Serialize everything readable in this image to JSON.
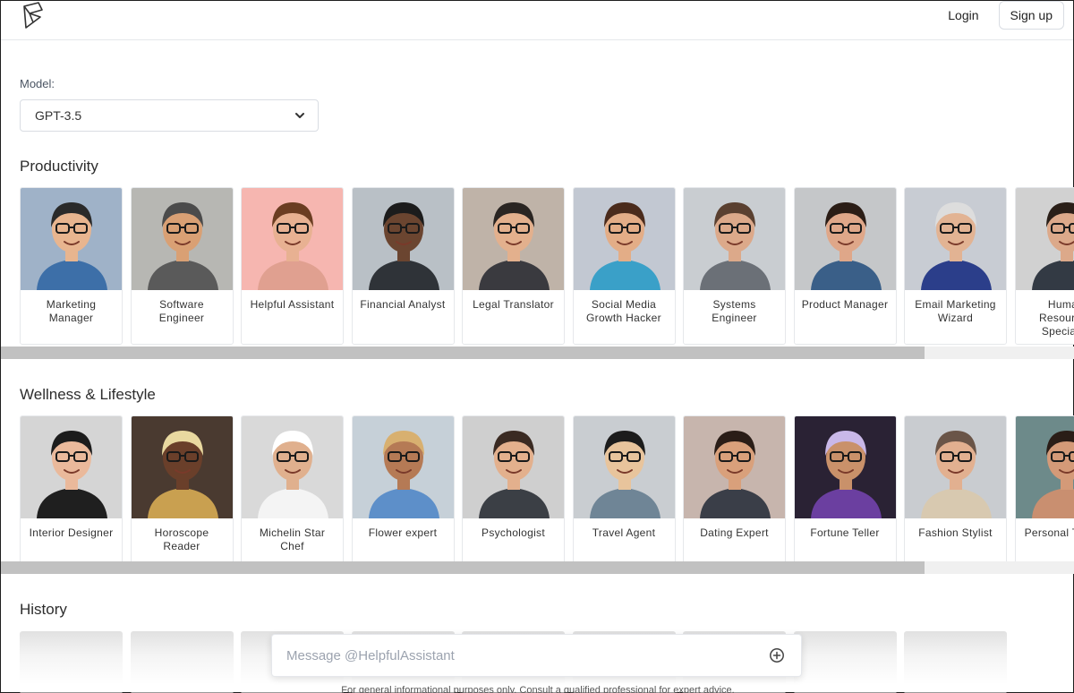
{
  "header": {
    "login_label": "Login",
    "signup_label": "Sign up"
  },
  "model": {
    "label": "Model:",
    "selected": "GPT-3.5"
  },
  "sections": {
    "productivity": {
      "title": "Productivity",
      "cards": [
        {
          "label": "Marketing Manager",
          "bg": "#9fb2c8",
          "skin": "#e8b58f",
          "hair": "#2a2a2a",
          "shirt": "#3d6fa8"
        },
        {
          "label": "Software Engineer",
          "bg": "#b7b7b3",
          "skin": "#d9a074",
          "hair": "#4b4b4b",
          "shirt": "#5a5a5a"
        },
        {
          "label": "Helpful Assistant",
          "bg": "#f6b6b0",
          "skin": "#e8b192",
          "hair": "#6b3d22",
          "shirt": "#e0a090"
        },
        {
          "label": "Financial Analyst",
          "bg": "#b9c0c6",
          "skin": "#6b4530",
          "hair": "#1c1c1c",
          "shirt": "#2f3338"
        },
        {
          "label": "Legal Translator",
          "bg": "#bfb3a8",
          "skin": "#e3b08d",
          "hair": "#2a2522",
          "shirt": "#3a3a3f"
        },
        {
          "label": "Social Media Growth Hacker",
          "bg": "#c2c8d2",
          "skin": "#e3ad87",
          "hair": "#4a2b1c",
          "shirt": "#3aa0c8"
        },
        {
          "label": "Systems Engineer",
          "bg": "#c9cdd1",
          "skin": "#dca98a",
          "hair": "#5a4030",
          "shirt": "#6b7077"
        },
        {
          "label": "Product Manager",
          "bg": "#c5c7c9",
          "skin": "#dfa789",
          "hair": "#2b1d16",
          "shirt": "#3a5f88"
        },
        {
          "label": "Email Marketing Wizard",
          "bg": "#c8ccd3",
          "skin": "#e2b393",
          "hair": "#dddddd",
          "shirt": "#2b3e8a"
        },
        {
          "label": "Human Resources Specialist",
          "bg": "#d1d1d1",
          "skin": "#dca98a",
          "hair": "#2a1f18",
          "shirt": "#333a44"
        }
      ]
    },
    "wellness": {
      "title": "Wellness & Lifestyle",
      "cards": [
        {
          "label": "Interior Designer",
          "bg": "#d5d5d5",
          "skin": "#eab99b",
          "hair": "#1c1c1c",
          "shirt": "#1f1f1f"
        },
        {
          "label": "Horoscope Reader",
          "bg": "#4a3a30",
          "skin": "#6a3f2a",
          "hair": "#e9d9a0",
          "shirt": "#c9a050"
        },
        {
          "label": "Michelin Star Chef",
          "bg": "#d9d9d9",
          "skin": "#e0b08e",
          "hair": "#ffffff",
          "shirt": "#f4f4f4"
        },
        {
          "label": "Flower expert",
          "bg": "#c6d0d8",
          "skin": "#b57a55",
          "hair": "#d8b070",
          "shirt": "#5d8fc9"
        },
        {
          "label": "Psychologist",
          "bg": "#cfcfcf",
          "skin": "#e3b08d",
          "hair": "#3a2a22",
          "shirt": "#3b3f45"
        },
        {
          "label": "Travel Agent",
          "bg": "#c9cdd1",
          "skin": "#e8c49c",
          "hair": "#1c1c1c",
          "shirt": "#6f8596"
        },
        {
          "label": "Dating Expert",
          "bg": "#c7b5ad",
          "skin": "#d9a07b",
          "hair": "#2a1d17",
          "shirt": "#3a3e48"
        },
        {
          "label": "Fortune Teller",
          "bg": "#2a2234",
          "skin": "#c9916a",
          "hair": "#c9b8e8",
          "shirt": "#6b3fa0"
        },
        {
          "label": "Fashion Stylist",
          "bg": "#c9ccd0",
          "skin": "#e2b090",
          "hair": "#6a5548",
          "shirt": "#d8c9b0"
        },
        {
          "label": "Personal Trainer",
          "bg": "#6d8a8a",
          "skin": "#d49a78",
          "hair": "#2a1d17",
          "shirt": "#c98f70"
        }
      ]
    },
    "history": {
      "title": "History"
    }
  },
  "composer": {
    "placeholder": "Message @HelpfulAssistant"
  },
  "disclaimer": "For general informational purposes only. Consult a qualified professional for expert advice."
}
